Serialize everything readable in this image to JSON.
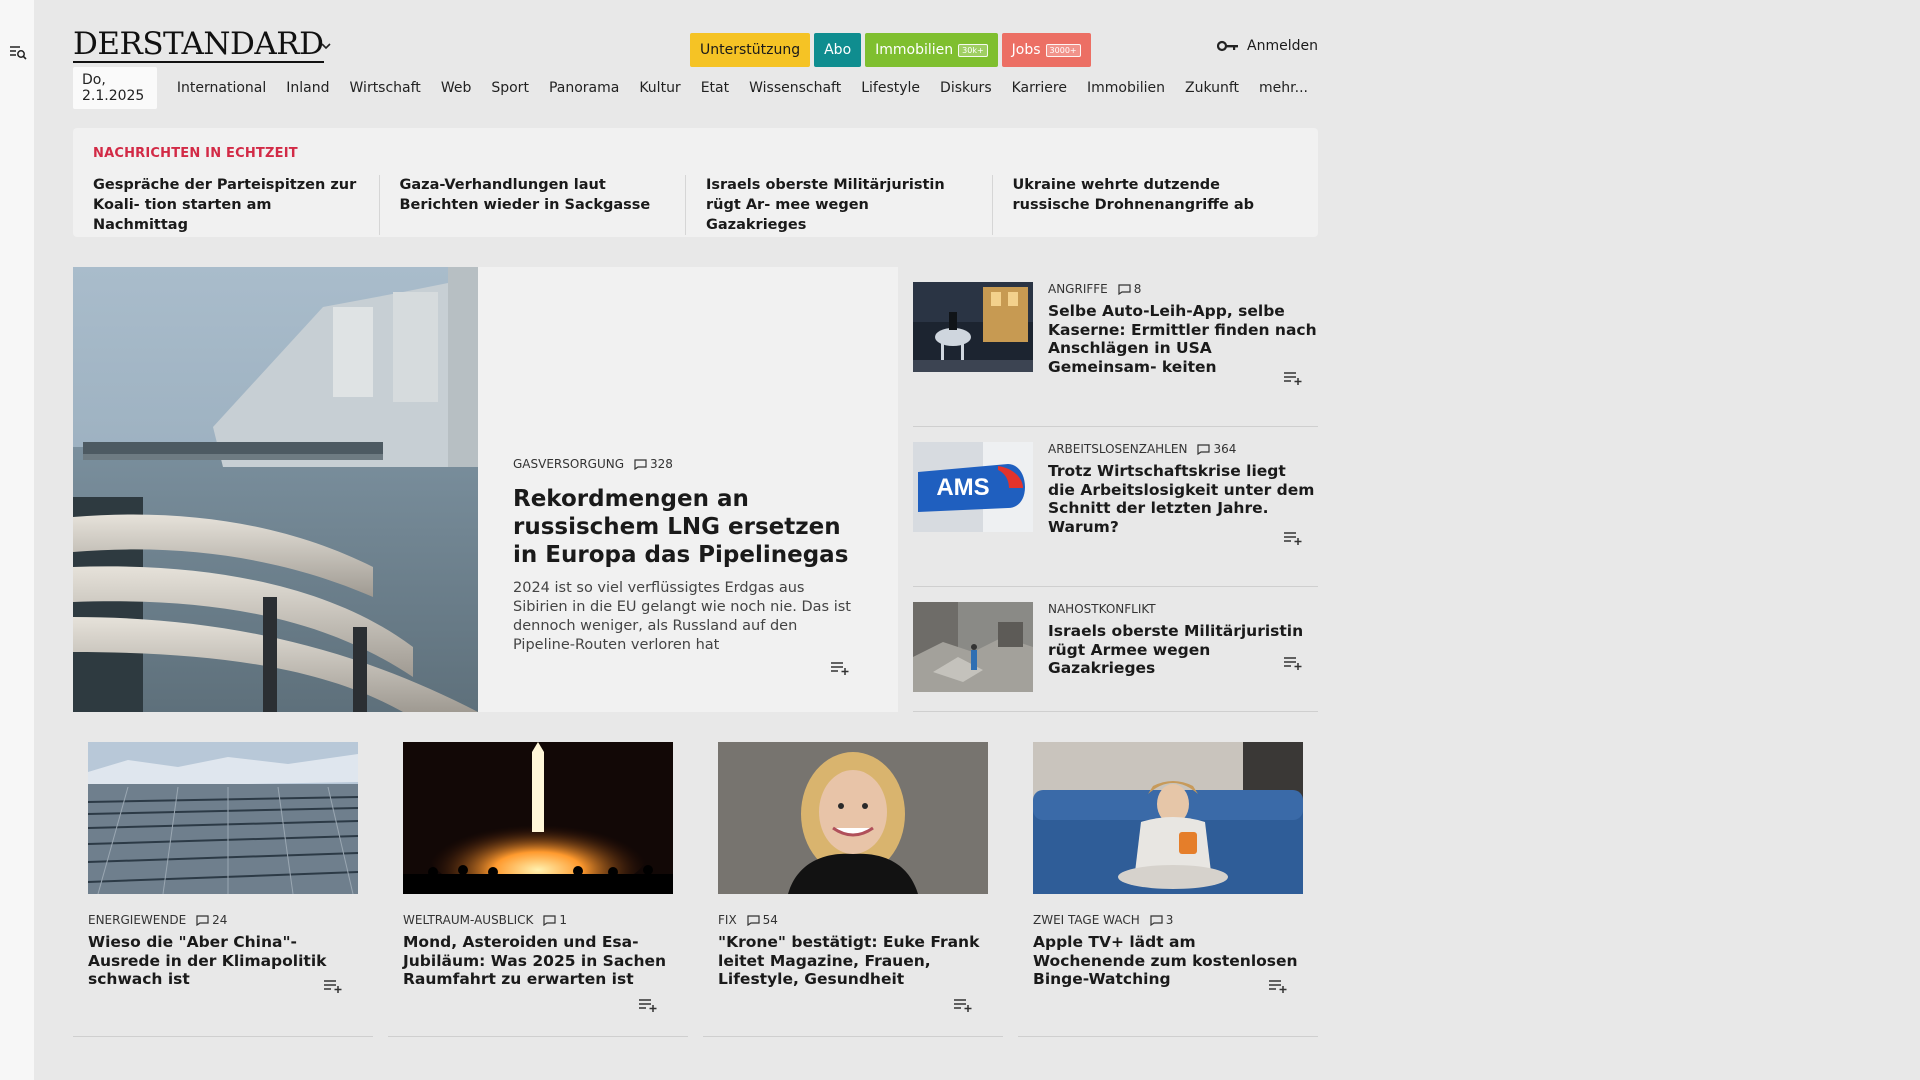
{
  "brand": {
    "logo": "DERSTANDARD"
  },
  "header": {
    "pills": [
      {
        "label": "Unterstützung",
        "bg": "#f5c325",
        "color": "#1a1a1a",
        "badge": ""
      },
      {
        "label": "Abo",
        "bg": "#0f8d8f",
        "color": "#ffffff",
        "badge": ""
      },
      {
        "label": "Immobilien",
        "bg": "#7fbf2f",
        "color": "#ffffff",
        "badge": "30k+"
      },
      {
        "label": "Jobs",
        "bg": "#ec6f64",
        "color": "#ffffff",
        "badge": "3000+"
      }
    ],
    "login_label": "Anmelden"
  },
  "nav": {
    "date": "Do, 2.1.2025",
    "items": [
      "International",
      "Inland",
      "Wirtschaft",
      "Web",
      "Sport",
      "Panorama",
      "Kultur",
      "Etat",
      "Wissenschaft",
      "Lifestyle",
      "Diskurs",
      "Karriere",
      "Immobilien",
      "Zukunft",
      "mehr..."
    ]
  },
  "ticker": {
    "title": "NACHRICHTEN IN ECHTZEIT",
    "items": [
      "Gespräche der Parteispitzen zur Koali- tion starten am Nachmittag",
      "Gaza-Verhandlungen laut Berichten wieder in Sackgasse",
      "Israels oberste Militärjuristin rügt Ar- mee wegen Gazakrieges",
      "Ukraine wehrte dutzende russische Drohnenangriffe ab"
    ]
  },
  "hero": {
    "kicker": "GASVERSORGUNG",
    "comments": "328",
    "title": "Rekordmengen an russischem LNG ersetzen in Europa das Pipelinegas",
    "teaser": "2024 ist so viel verflüssigtes Erdgas aus Sibirien in die EU gelangt wie noch nie. Das ist dennoch weniger, als Russland auf den Pipeline-Routen verloren hat"
  },
  "side": [
    {
      "kicker": "ANGRIFFE",
      "comments": "8",
      "title": "Selbe Auto-Leih-App, selbe Kaserne: Ermittler finden nach Anschlägen in USA Gemeinsam- keiten"
    },
    {
      "kicker": "ARBEITSLOSENZAHLEN",
      "comments": "364",
      "title": "Trotz Wirtschaftskrise liegt die Arbeitslosigkeit unter dem Schnitt der letzten Jahre. Warum?",
      "logo_text": "AMS"
    },
    {
      "kicker": "NAHOSTKONFLIKT",
      "comments": "",
      "title": "Israels oberste Militärjuristin rügt Armee wegen Gazakrieges"
    }
  ],
  "cards": [
    {
      "kicker": "ENERGIEWENDE",
      "comments": "24",
      "title": "Wieso die \"Aber China\"-Ausrede in der Klimapolitik schwach ist"
    },
    {
      "kicker": "WELTRAUM-AUSBLICK",
      "comments": "1",
      "title": "Mond, Asteroiden und Esa-Jubiläum: Was 2025 in Sachen Raumfahrt zu erwarten ist"
    },
    {
      "kicker": "FIX",
      "comments": "54",
      "title": "\"Krone\" bestätigt: Euke Frank leitet Magazine, Frauen, Lifestyle, Gesundheit"
    },
    {
      "kicker": "ZWEI TAGE WACH",
      "comments": "3",
      "title": "Apple TV+ lädt am Wochenende zum kostenlosen Binge-Watching"
    }
  ]
}
